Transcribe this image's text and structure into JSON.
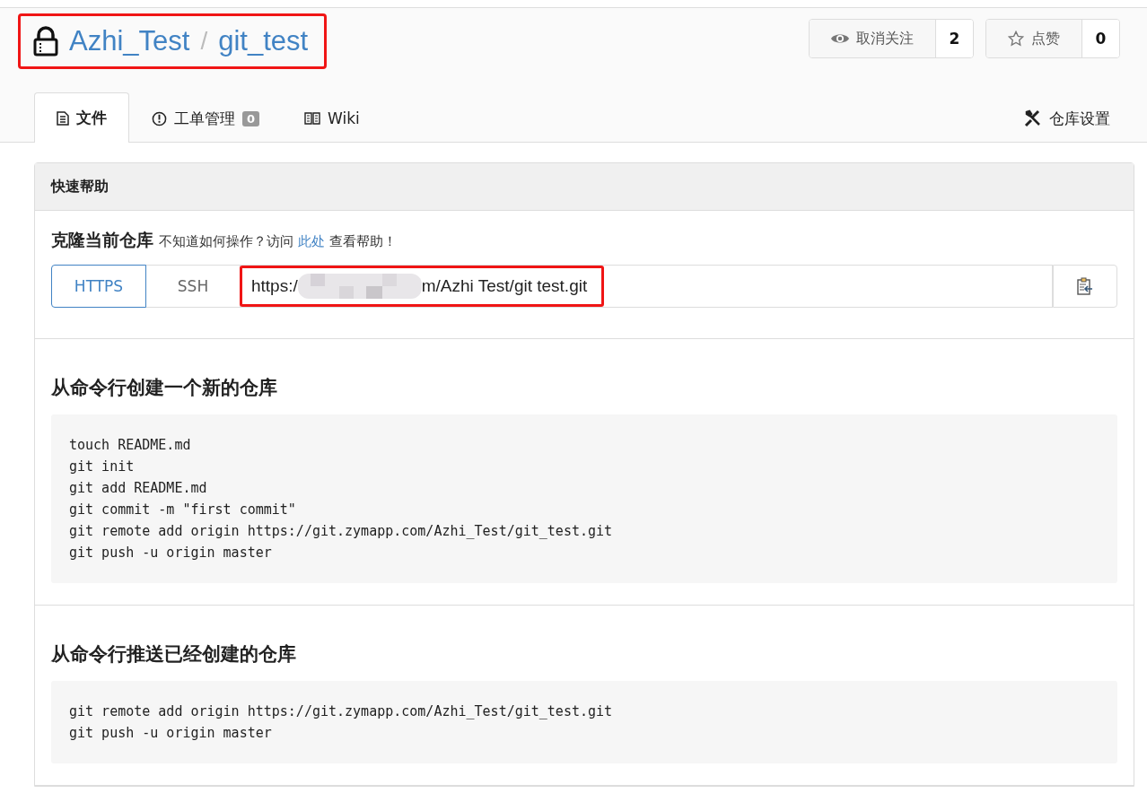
{
  "repo": {
    "owner": "Azhi_Test",
    "separator": "/",
    "name": "git_test",
    "locked": true
  },
  "actions": [
    {
      "kind": "watch",
      "label": "取消关注",
      "count": "2"
    },
    {
      "kind": "star",
      "label": "点赞",
      "count": "0"
    }
  ],
  "tabs": [
    {
      "kind": "files",
      "label": "文件",
      "selected": true
    },
    {
      "kind": "issues",
      "label": "工单管理",
      "badge": "0",
      "selected": false
    },
    {
      "kind": "wiki",
      "label": "Wiki",
      "selected": false
    }
  ],
  "settings": {
    "label": "仓库设置"
  },
  "panel": {
    "title": "快速帮助",
    "clone": {
      "title": "克隆当前仓库",
      "hint_before": "不知道如何操作？访问",
      "link": "此处",
      "hint_after": "查看帮助！",
      "protocols": [
        {
          "label": "HTTPS",
          "selected": true
        },
        {
          "label": "SSH",
          "selected": false
        }
      ],
      "url_start": "https:/",
      "url_end": "m/Azhi Test/git test.git"
    },
    "sections": [
      {
        "title": "从命令行创建一个新的仓库",
        "code": [
          "touch README.md",
          "git init",
          "git add README.md",
          "git commit -m \"first commit\"",
          "git remote add origin https://git.zymapp.com/Azhi_Test/git_test.git",
          "git push -u origin master"
        ]
      },
      {
        "title": "从命令行推送已经创建的仓库",
        "code": [
          "git remote add origin https://git.zymapp.com/Azhi_Test/git_test.git",
          "git push -u origin master"
        ]
      }
    ]
  }
}
